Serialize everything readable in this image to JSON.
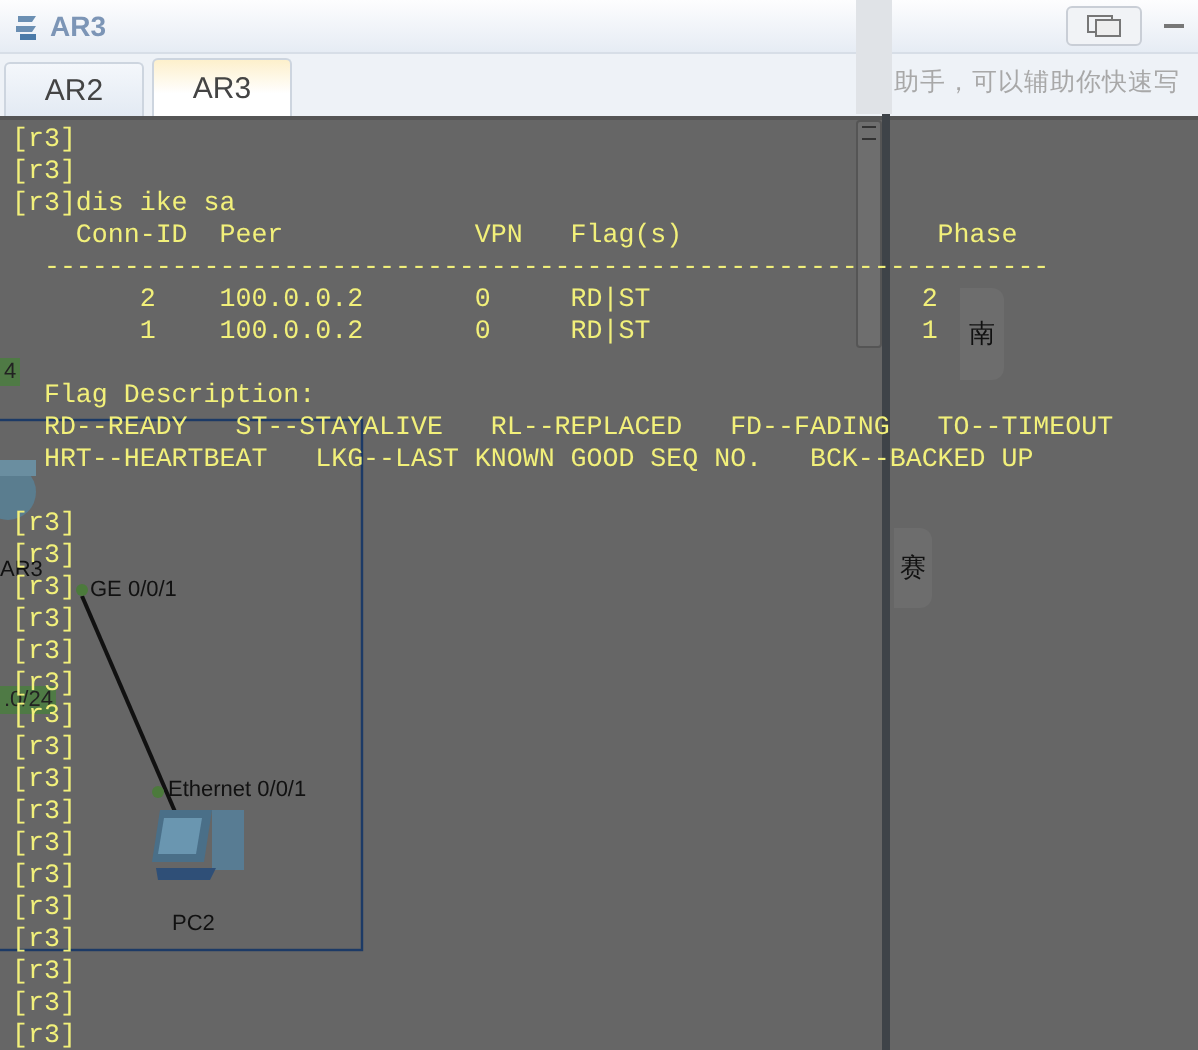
{
  "window": {
    "title": "AR3"
  },
  "tabs": [
    {
      "label": "AR2",
      "selected": false
    },
    {
      "label": "AR3",
      "selected": true
    }
  ],
  "behind_window": {
    "hint": "助手，可以辅助你快速写",
    "side_buttons": [
      "南",
      "赛"
    ]
  },
  "topology": {
    "nodes": [
      {
        "kind": "router",
        "label": "AR3"
      },
      {
        "kind": "pc",
        "label": "PC2"
      }
    ],
    "ports": [
      "GE 0/0/1",
      "Ethernet 0/0/1"
    ],
    "subnet_tags": [
      "4",
      ".0/24"
    ]
  },
  "terminal": {
    "blocks": [
      [
        "[r3]",
        "[r3]",
        "[r3]dis ike sa",
        "    Conn-ID  Peer            VPN   Flag(s)                Phase",
        "  ---------------------------------------------------------------",
        "        2    100.0.0.2       0     RD|ST                 2",
        "        1    100.0.0.2       0     RD|ST                 1"
      ],
      [
        "  Flag Description:",
        "  RD--READY   ST--STAYALIVE   RL--REPLACED   FD--FADING   TO--TIMEOUT",
        "  HRT--HEARTBEAT   LKG--LAST KNOWN GOOD SEQ NO.   BCK--BACKED UP"
      ],
      [
        "[r3]",
        "[r3]",
        "[r3]",
        "[r3]",
        "[r3]",
        "[r3]",
        "[r3]",
        "[r3]",
        "[r3]",
        "[r3]",
        "[r3]",
        "[r3]",
        "[r3]",
        "[r3]",
        "[r3]",
        "[r3]",
        "[r3]"
      ]
    ]
  }
}
